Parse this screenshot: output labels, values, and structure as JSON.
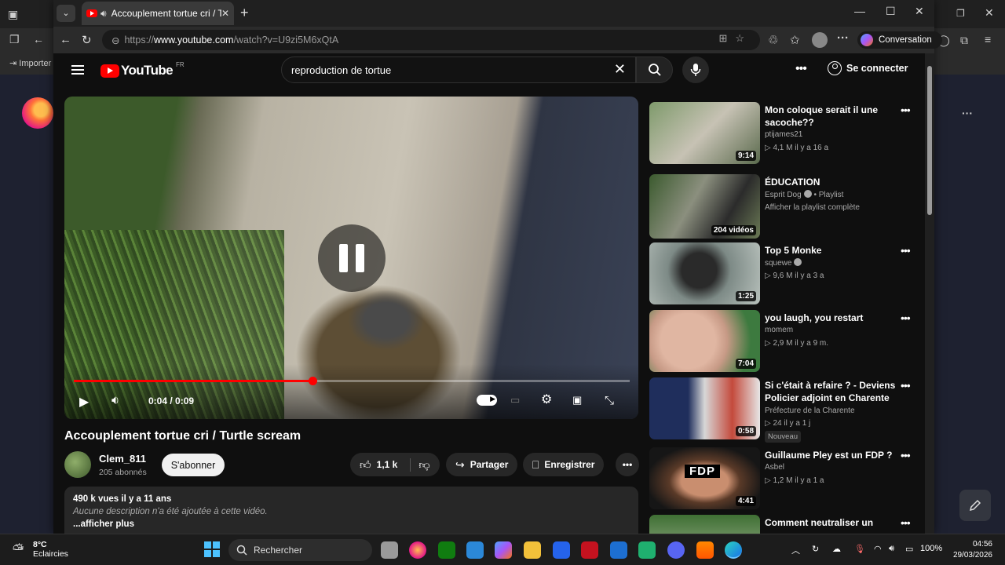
{
  "outer": {
    "import_label": "Importer"
  },
  "tab": {
    "title": "Accouplement tortue cri / Tur"
  },
  "address": {
    "prefix": "https://",
    "host": "www.youtube.com",
    "path": "/watch?v=U9zi5M6xQtA"
  },
  "copilot": {
    "label": "Conversation"
  },
  "yt": {
    "logo_text": "YouTube",
    "region": "FR",
    "search_value": "reproduction de tortue",
    "signin": "Se connecter"
  },
  "player": {
    "time": "0:04 / 0:09",
    "progress": 0.43
  },
  "video": {
    "title": "Accouplement tortue cri / Turtle scream",
    "channel": "Clem_811",
    "subscribers": "205 abonnés",
    "subscribe": "S'abonner",
    "likes": "1,1 k",
    "share": "Partager",
    "save": "Enregistrer",
    "views_date": "490 k vues  il y a 11 ans",
    "no_desc": "Aucune description n'a été ajoutée à cette vidéo.",
    "more": "...afficher plus"
  },
  "recs": [
    {
      "title": "Mon coloque serait il une sacoche??",
      "channel": "ptijames21",
      "meta": "▷ 4,1 M   il y a 16 a",
      "duration": "9:14",
      "verified": false
    },
    {
      "title": "ÉDUCATION",
      "channel": "Esprit Dog",
      "channel_suffix": " • Playlist",
      "meta": "Afficher la playlist complète",
      "duration": "204 vidéos",
      "verified": true
    },
    {
      "title": "Top 5 Monke",
      "channel": "squewe",
      "meta": "▷ 9,6 M   il y a 3 a",
      "duration": "1:25",
      "verified": true
    },
    {
      "title": "you laugh, you restart",
      "channel": "momem",
      "meta": "▷ 2,9 M   il y a 9 m.",
      "duration": "7:04",
      "verified": false
    },
    {
      "title": "Si c'était à refaire ? - Deviens Policier adjoint en Charente",
      "channel": "Préfecture de la Charente",
      "meta": "▷ 24   il y a 1 j",
      "duration": "0:58",
      "badge": "Nouveau",
      "verified": false
    },
    {
      "title": "Guillaume Pley est un FDP ?",
      "channel": "Asbel",
      "meta": "▷ 1,2 M   il y a 1 a",
      "duration": "4:41",
      "thumb_text": "FDP",
      "verified": false
    },
    {
      "title": "Comment neutraliser un",
      "channel": "",
      "meta": "",
      "duration": "",
      "verified": false
    }
  ],
  "taskbar": {
    "temp": "8°C",
    "weather": "Eclaircies",
    "search": "Rechercher",
    "battery": "100%",
    "time": "04:56",
    "date": "29/03/2026"
  },
  "colors": {
    "yt_red": "#ff0000",
    "bg": "#0f0f0f"
  }
}
